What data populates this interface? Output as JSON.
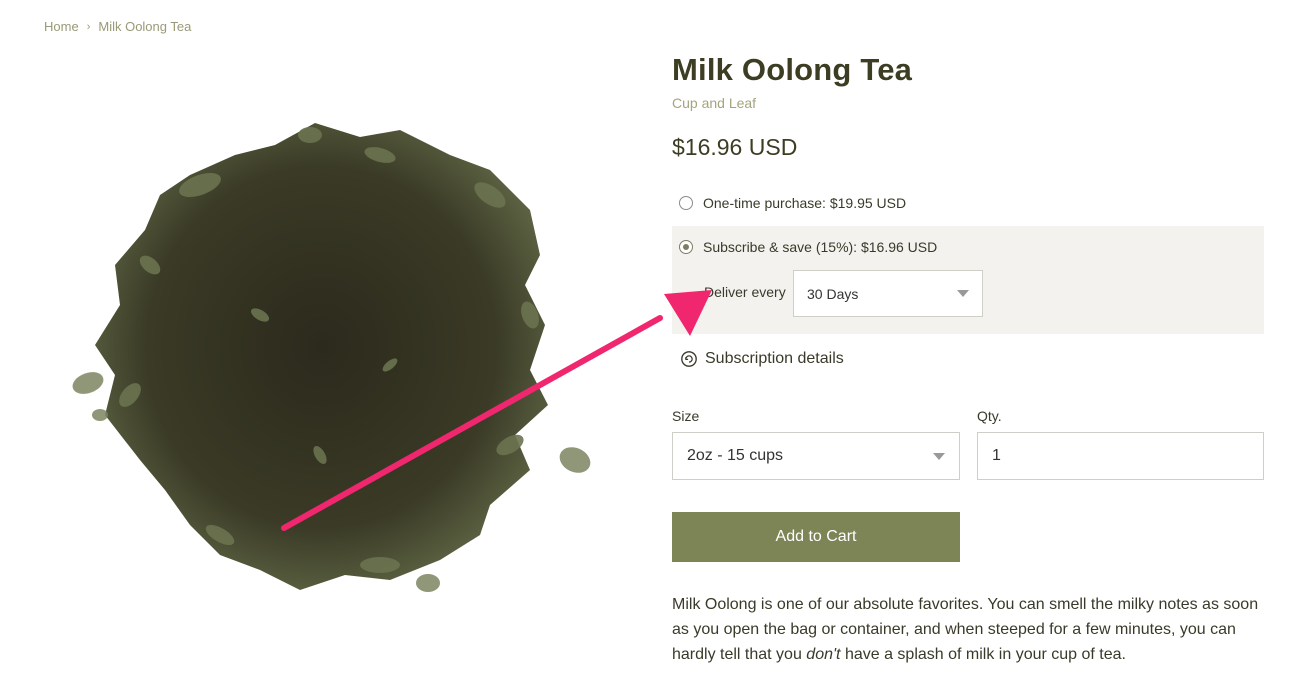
{
  "breadcrumb": {
    "home": "Home",
    "separator": "›",
    "current": "Milk Oolong Tea"
  },
  "product": {
    "title": "Milk Oolong Tea",
    "vendor": "Cup and Leaf",
    "price": "$16.96 USD",
    "image_icon": "tea-leaves-image"
  },
  "purchase_options": {
    "one_time": {
      "label": "One-time purchase: $19.95 USD",
      "selected": false
    },
    "subscribe": {
      "label": "Subscribe & save (15%): $16.96 USD",
      "selected": true
    },
    "deliver_label": "Deliver every",
    "deliver_value": "30 Days"
  },
  "subscription_details": "Subscription details",
  "size": {
    "label": "Size",
    "value": "2oz - 15 cups"
  },
  "qty": {
    "label": "Qty.",
    "value": "1"
  },
  "add_to_cart": "Add to Cart",
  "description": {
    "part1": "Milk Oolong is one of our absolute favorites. You can smell the milky notes as soon as you open the bag or container, and when steeped for a few minutes, you can hardly tell that you ",
    "emphasis": "don't",
    "part2": " have a splash of milk in your cup of tea."
  },
  "colors": {
    "button": "#7d8557",
    "annotation_arrow": "#f0266f",
    "vendor": "#a6a47e"
  }
}
